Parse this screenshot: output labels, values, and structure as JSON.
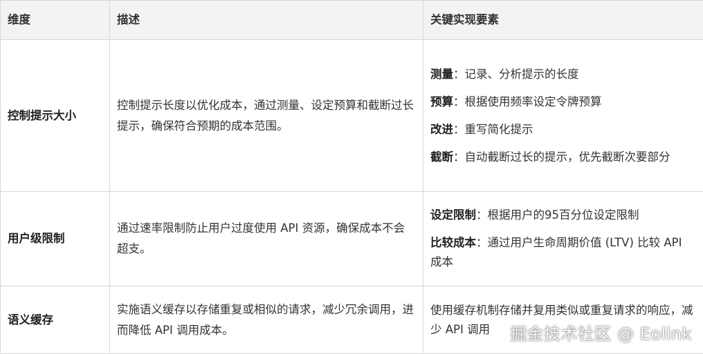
{
  "table": {
    "headers": [
      "维度",
      "描述",
      "关键实现要素"
    ],
    "rows": [
      {
        "dimension": "控制提示大小",
        "description": "控制提示长度以优化成本，通过测量、设定预算和截断过长提示，确保符合预期的成本范围。",
        "elements": [
          {
            "key": "测量",
            "sep": "：",
            "text": "记录、分析提示的长度"
          },
          {
            "key": "预算",
            "sep": "：",
            "text": "根据使用频率设定令牌预算"
          },
          {
            "key": "改进",
            "sep": "：",
            "text": "重写简化提示"
          },
          {
            "key": "截断",
            "sep": "：",
            "text": "自动截断过长的提示，优先截断次要部分"
          }
        ]
      },
      {
        "dimension": "用户级限制",
        "description": "通过速率限制防止用户过度使用 API 资源，确保成本不会超支。",
        "elements": [
          {
            "key": "设定限制",
            "sep": "：",
            "text": "根据用户的95百分位设定限制"
          },
          {
            "key": "比较成本",
            "sep": "：",
            "text": "通过用户生命周期价值 (LTV) 比较 API 成本"
          }
        ]
      },
      {
        "dimension": "语义缓存",
        "description": "实施语义缓存以存储重复或相似的请求，减少冗余调用，进而降低 API 调用成本。",
        "elements": [
          {
            "key": "",
            "sep": "",
            "text": "使用缓存机制存储并复用类似或重复请求的响应，减少 API 调用"
          }
        ]
      }
    ]
  },
  "watermark": "掘金技术社区 @ Eolink"
}
